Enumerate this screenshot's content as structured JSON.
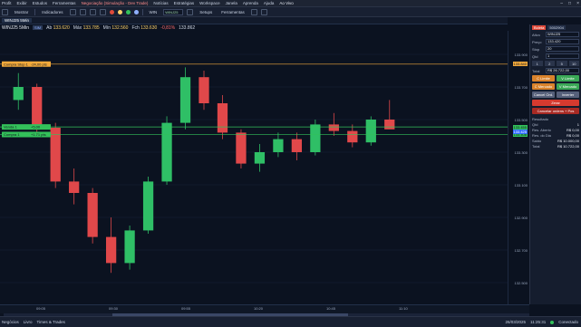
{
  "menubar": {
    "items": [
      "Profit",
      "Exibir",
      "Estudos",
      "Ferramentas",
      "Negociação (Simulação - Dev Trade)",
      "Notícias",
      "Estratégias",
      "Workspace",
      "Janela",
      "Aprenda",
      "Ajuda"
    ],
    "hint": "Ao Vivo"
  },
  "toolbar": {
    "buttons": [
      "Mostrar",
      "Indicadores",
      "WIN",
      "Setups",
      "Ferramentas"
    ],
    "field": "WINJ25",
    "swatches": [
      "#e04a3a",
      "#ffd36b",
      "#33c15a",
      "#8fb0ff"
    ]
  },
  "tabstrip": {
    "tabs": [
      "WINJ25 5Min"
    ]
  },
  "chart_header": {
    "symbol": "WINJ25 5Min",
    "tag": "SIM",
    "ab_label": "Ab",
    "ab": "133.620",
    "max_label": "Máx",
    "max": "133.785",
    "min_label": "Mín",
    "min": "132.560",
    "fch_label": "Fch",
    "fch": "133.630",
    "var": "-0,81%",
    "delta": "133.862"
  },
  "lines": {
    "stop": {
      "label": "Compra Stop 1",
      "price": "133.840",
      "pnl": "-24,00 pts",
      "color": "#f2a93b"
    },
    "venda": {
      "label": "Venda 1",
      "price": "133.455",
      "pnl": "+5,00",
      "color": "#33c15a"
    },
    "compra": {
      "label": "Compra 1",
      "price": "133.408",
      "pnl": "+1.71 pts",
      "color": "#33c15a"
    },
    "last_price": "133.425"
  },
  "order_panel": {
    "tab": "Boleta",
    "account": "5002904",
    "fields": [
      {
        "label": "Ativo",
        "value": "WINJ25"
      },
      {
        "label": "Preço",
        "value": "133.420"
      },
      {
        "label": "Stop",
        "value": "20"
      },
      {
        "label": "Qtd",
        "value": "1"
      }
    ],
    "qty_buttons": [
      "1",
      "2",
      "5",
      "10"
    ],
    "total_label": "Total",
    "total": "R$ 26.722,00",
    "buttons": {
      "c_limite": "C Limite",
      "v_limite": "V Limite",
      "c_mercado": "C Mercado",
      "v_mercado": "V Mercado",
      "cancel": "Cancel Ord.",
      "inverter": "Inverter",
      "zerar": "Zerar",
      "cancelar_todas": "Cancelar ordens + Pos"
    },
    "result_label": "Resultado",
    "rows": [
      {
        "label": "Qtd",
        "value": "1"
      },
      {
        "label": "Res. Aberto",
        "value": "R$ 0,00"
      },
      {
        "label": "Res. do Dia",
        "value": "R$ 0,00"
      },
      {
        "label": "Saldo",
        "value": "R$ 10.000,00"
      },
      {
        "label": "Total",
        "value": "R$ 10.722,00"
      }
    ]
  },
  "statusbar": {
    "items": [
      "Negócios",
      "Livro",
      "Times & Trades"
    ],
    "date": "26/03/2025",
    "time": "11:25:31",
    "status": "Conectado"
  },
  "price_ticks": [
    "133.900",
    "133.700",
    "133.500",
    "133.300",
    "133.100",
    "132.900",
    "132.700",
    "132.500"
  ],
  "time_ticks": [
    "09:05",
    "09:30",
    "09:55",
    "10:20",
    "10:45",
    "11:10"
  ],
  "chart_data": {
    "type": "candlestick",
    "title": "WINJ25 5Min",
    "y_range": [
      132400,
      134000
    ],
    "candles": [
      {
        "t": "09:00",
        "o": 133620,
        "h": 133785,
        "l": 133560,
        "c": 133700
      },
      {
        "t": "09:05",
        "o": 133700,
        "h": 133720,
        "l": 133420,
        "c": 133450
      },
      {
        "t": "09:10",
        "o": 133450,
        "h": 133480,
        "l": 133080,
        "c": 133120
      },
      {
        "t": "09:15",
        "o": 133120,
        "h": 133200,
        "l": 132980,
        "c": 133050
      },
      {
        "t": "09:20",
        "o": 133050,
        "h": 133080,
        "l": 132740,
        "c": 132780
      },
      {
        "t": "09:25",
        "o": 132780,
        "h": 132900,
        "l": 132560,
        "c": 132620
      },
      {
        "t": "09:30",
        "o": 132620,
        "h": 132850,
        "l": 132580,
        "c": 132820
      },
      {
        "t": "09:35",
        "o": 132820,
        "h": 133150,
        "l": 132800,
        "c": 133120
      },
      {
        "t": "09:40",
        "o": 133120,
        "h": 133520,
        "l": 133100,
        "c": 133480
      },
      {
        "t": "09:45",
        "o": 133480,
        "h": 133820,
        "l": 133440,
        "c": 133760
      },
      {
        "t": "09:50",
        "o": 133760,
        "h": 133800,
        "l": 133560,
        "c": 133600
      },
      {
        "t": "09:55",
        "o": 133600,
        "h": 133650,
        "l": 133380,
        "c": 133420
      },
      {
        "t": "10:00",
        "o": 133420,
        "h": 133440,
        "l": 133200,
        "c": 133230
      },
      {
        "t": "10:05",
        "o": 133230,
        "h": 133350,
        "l": 133180,
        "c": 133300
      },
      {
        "t": "10:10",
        "o": 133300,
        "h": 133420,
        "l": 133270,
        "c": 133380
      },
      {
        "t": "10:15",
        "o": 133380,
        "h": 133420,
        "l": 133250,
        "c": 133300
      },
      {
        "t": "10:20",
        "o": 133300,
        "h": 133500,
        "l": 133280,
        "c": 133470
      },
      {
        "t": "10:25",
        "o": 133470,
        "h": 133540,
        "l": 133400,
        "c": 133430
      },
      {
        "t": "10:30",
        "o": 133430,
        "h": 133470,
        "l": 133330,
        "c": 133360
      },
      {
        "t": "10:35",
        "o": 133360,
        "h": 133520,
        "l": 133340,
        "c": 133500
      },
      {
        "t": "10:40",
        "o": 133500,
        "h": 133620,
        "l": 133470,
        "c": 133440
      }
    ]
  }
}
